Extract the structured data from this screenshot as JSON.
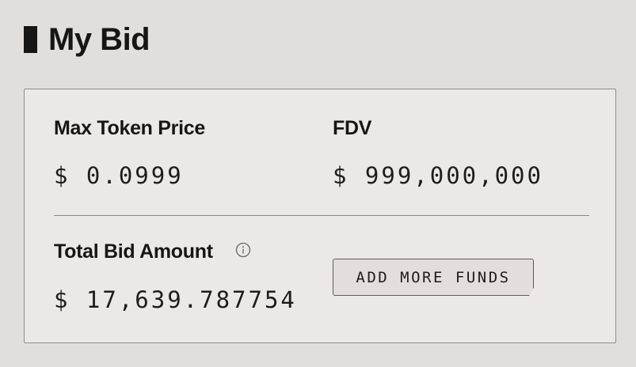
{
  "header": {
    "title": "My Bid"
  },
  "bid": {
    "max_token_price": {
      "label": "Max Token Price",
      "value": "$ 0.0999"
    },
    "fdv": {
      "label": "FDV",
      "value": "$ 999,000,000"
    },
    "total_bid_amount": {
      "label": "Total Bid Amount",
      "value": "$ 17,639.787754",
      "info_icon": "info-icon"
    },
    "add_funds_button": {
      "label": "ADD MORE FUNDS"
    }
  },
  "colors": {
    "background": "#e0dfde",
    "card": "#ebe9e7",
    "text": "#161616",
    "border": "#8f8d8a"
  }
}
